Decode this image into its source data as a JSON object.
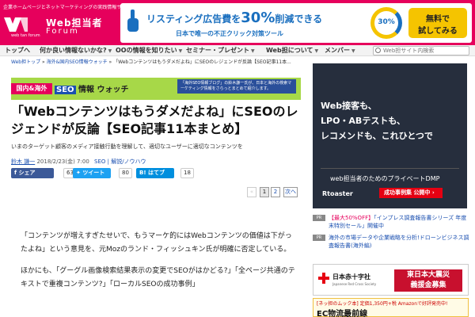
{
  "header": {
    "tagline": "企業ホームページとネットマーケティングの実践情報サイト",
    "logo_site": "Web担当者",
    "logo_sub": "Forum",
    "logo_small": "web tan forum"
  },
  "ad_banner": {
    "main_pre": "リスティング広告費を",
    "main_pct": "30%",
    "main_post": "削減できる",
    "sub": "日本で唯一の不正クリック対策ツール",
    "gauge": "30%",
    "cta_line1": "無料で",
    "cta_line2": "試してみる",
    "color_accent": "#1a6fbf",
    "color_cta": "#f5c400"
  },
  "nav": {
    "items": [
      {
        "label": "トップへ",
        "dropdown": false
      },
      {
        "label": "何か良い情報ないかな?",
        "dropdown": true
      },
      {
        "label": "OOの情報を知りたい",
        "dropdown": true
      },
      {
        "label": "セミナー・プレゼント",
        "dropdown": true
      },
      {
        "label": "Web担について",
        "dropdown": true
      },
      {
        "label": "メンバー",
        "dropdown": true
      }
    ],
    "search_placeholder": "Web担サイト内検索"
  },
  "breadcrumb": {
    "items": [
      "Web担トップ",
      "海外&国内SEO情報ウォッチ"
    ],
    "current": "「Webコンテンツはもうダメだよね」にSEOのレジェンドが反論【SEO記事11本..."
  },
  "category_banner": {
    "left": "国内&海外",
    "right_box": "SEO",
    "right_text": "情報 ウォッチ",
    "note": "「海外SEO情報ブログ」の鈴木謙一氏が、日本と海外の検索マーケティング情報をさらっとまとめて紹介します。"
  },
  "article": {
    "title": "「Webコンテンツはもうダメだよね」にSEOのレジェンドが反論【SEO記事11本まとめ】",
    "subtitle": "いまのターゲット顧客のメディア接触行動を理解して、適切なユーザーに適切なコンテンツを",
    "author": "鈴木 謙一",
    "date": "2018/2/23(金) 7:00",
    "tags": "SEO | 解説/ノウハウ",
    "share": {
      "facebook_label": "シェア",
      "facebook_count": "63",
      "twitter_label": "ツイート",
      "twitter_count": "80",
      "hatena_label": "はてブ",
      "hatena_count": "18"
    },
    "pager": {
      "prev": "",
      "pages": [
        "1",
        "2"
      ],
      "current_page": "1",
      "next": "次へ"
    },
    "paragraphs": [
      "「コンテンツが増えすぎたせいで、もうマーケ的にはWebコンテンツの価値は下がったよね」という意見を、元Mozのランド・フィッシュキン氏が明確に否定している。",
      "ほかにも、「グーグル画像検索結果表示の変更でSEOがはかどる?」「全ページ共通のテキストで重複コンテンツ?」「ローカルSEOの成功事例」"
    ]
  },
  "side_ad": {
    "lines": [
      "Web接客も、",
      "LPO・ABテストも、",
      "レコメンドも、これひとつで"
    ],
    "dmp": "web担当者のためのプライベートDMP",
    "brand": "Rtoaster",
    "button": "成功事例集 公開中",
    "bg_color": "#262e3d"
  },
  "pr_list": [
    {
      "tag": "PR",
      "pre": "【最大50%OFF】",
      "text": "「インプレス調査報告書シリーズ 年度末特別セール」開催中"
    },
    {
      "tag": "PR",
      "pre": "",
      "text": "海外の市場データや企業戦略を分析!ドローンビジネス調査報告書(海外編)"
    }
  ],
  "redcross": {
    "name": "日本赤十字社",
    "english": "Japanese Red Cross Society",
    "message_line1": "東日本大震災",
    "message_line2": "義援金募集"
  },
  "ec_ad": {
    "top_pre": "[ネッ担のムック本]",
    "top_price": "定価1,350円+税",
    "top_post": "Amazonで好評発売中!",
    "main": "EC物流最前線"
  }
}
